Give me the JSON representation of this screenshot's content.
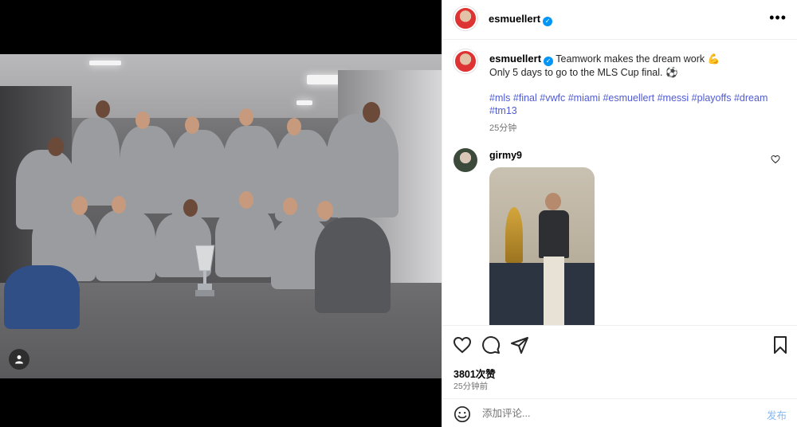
{
  "post": {
    "username": "esmuellert",
    "verified": true,
    "more_icon": "more-horizontal-icon"
  },
  "caption": {
    "username": "esmuellert",
    "line1": "Teamwork makes the dream work 💪",
    "line2": "Only 5 days to go to the MLS Cup final. ⚽",
    "hashtags": [
      "#mls",
      "#final",
      "#vwfc",
      "#miami",
      "#esmuellert",
      "#messi",
      "#playoffs",
      "#dream",
      "#tm13"
    ],
    "time": "25分钟"
  },
  "comment": {
    "username": "girmy9",
    "like_icon": "heart-outline-icon"
  },
  "actions": {
    "likes": "3801次赞",
    "time": "25分钟前",
    "icons": [
      "heart-icon",
      "comment-icon",
      "share-icon",
      "bookmark-icon"
    ]
  },
  "comment_box": {
    "placeholder": "添加评论...",
    "post_label": "发布",
    "emoji_icon": "emoji-icon"
  },
  "colors": {
    "link": "#4f5bd5",
    "verified": "#0095f6",
    "post_button": "#82b9f7",
    "muted": "#737373"
  }
}
